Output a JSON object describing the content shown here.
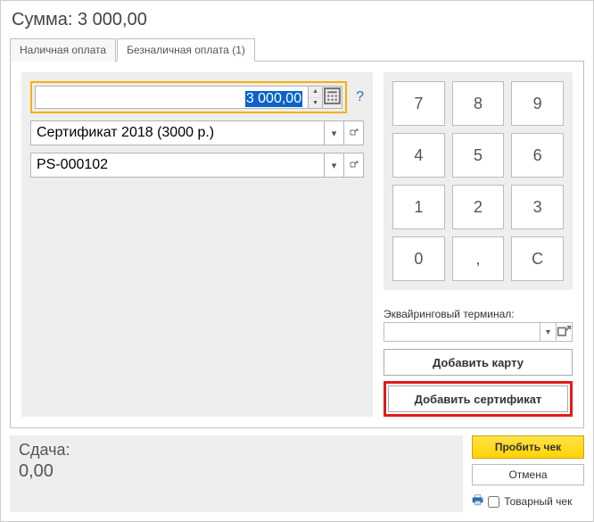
{
  "title_prefix": "Сумма:",
  "title_amount": "3 000,00",
  "tabs": {
    "cash": "Наличная оплата",
    "cashless": "Безналичная оплата (1)"
  },
  "payment": {
    "amount": "3 000,00",
    "amount_help": "?",
    "certificate_type": "Сертификат 2018 (3000 р.)",
    "certificate_number": "PS-000102"
  },
  "keypad": [
    "7",
    "8",
    "9",
    "4",
    "5",
    "6",
    "1",
    "2",
    "3",
    "0",
    ",",
    "C"
  ],
  "terminal_label": "Эквайринговый терминал:",
  "terminal_value": "",
  "buttons": {
    "add_card": "Добавить карту",
    "add_cert": "Добавить сертификат",
    "punch": "Пробить чек",
    "cancel": "Отмена"
  },
  "change": {
    "label": "Сдача:",
    "value": "0,00"
  },
  "goods_receipt": "Товарный чек"
}
